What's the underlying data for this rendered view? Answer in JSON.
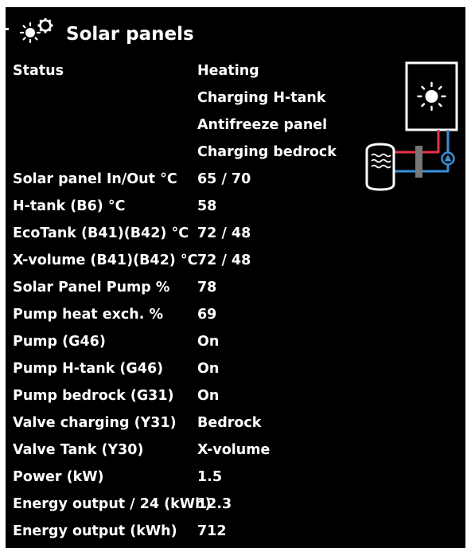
{
  "title": "Solar panels",
  "status": {
    "label": "Status",
    "values": [
      "Heating",
      "Charging H-tank",
      "Antifreeze panel",
      "Charging bedrock"
    ]
  },
  "rows": [
    {
      "label": "Solar panel In/Out °C",
      "value": "65 / 70"
    },
    {
      "label": "H-tank (B6) °C",
      "value": "58"
    },
    {
      "label": "EcoTank (B41)(B42) °C",
      "value": "72 / 48"
    },
    {
      "label": "X-volume (B41)(B42) °C",
      "value": "72 / 48"
    },
    {
      "label": "Solar Panel Pump %",
      "value": "78"
    },
    {
      "label": "Pump heat exch. %",
      "value": "69"
    },
    {
      "label": "Pump (G46)",
      "value": "On"
    },
    {
      "label": "Pump H-tank (G46)",
      "value": "On"
    },
    {
      "label": "Pump bedrock (G31)",
      "value": "On"
    },
    {
      "label": "Valve charging (Y31)",
      "value": "Bedrock"
    },
    {
      "label": "Valve Tank (Y30)",
      "value": "X-volume"
    },
    {
      "label": "Power (kW)",
      "value": "1.5"
    },
    {
      "label": "Energy output / 24 (kWh)",
      "value": "12.3"
    },
    {
      "label": "Energy output (kWh)",
      "value": "712"
    }
  ],
  "icons": {
    "title": "sun-icon",
    "panel": "solar-panel-icon",
    "tank": "tank-icon",
    "pump": "pump-icon",
    "exchanger": "heat-exchanger-icon"
  },
  "colors": {
    "background": "#000000",
    "text": "#ffffff",
    "hot_pipe": "#e8334a",
    "cold_pipe": "#3a8fd6",
    "exchanger": "#777777"
  }
}
